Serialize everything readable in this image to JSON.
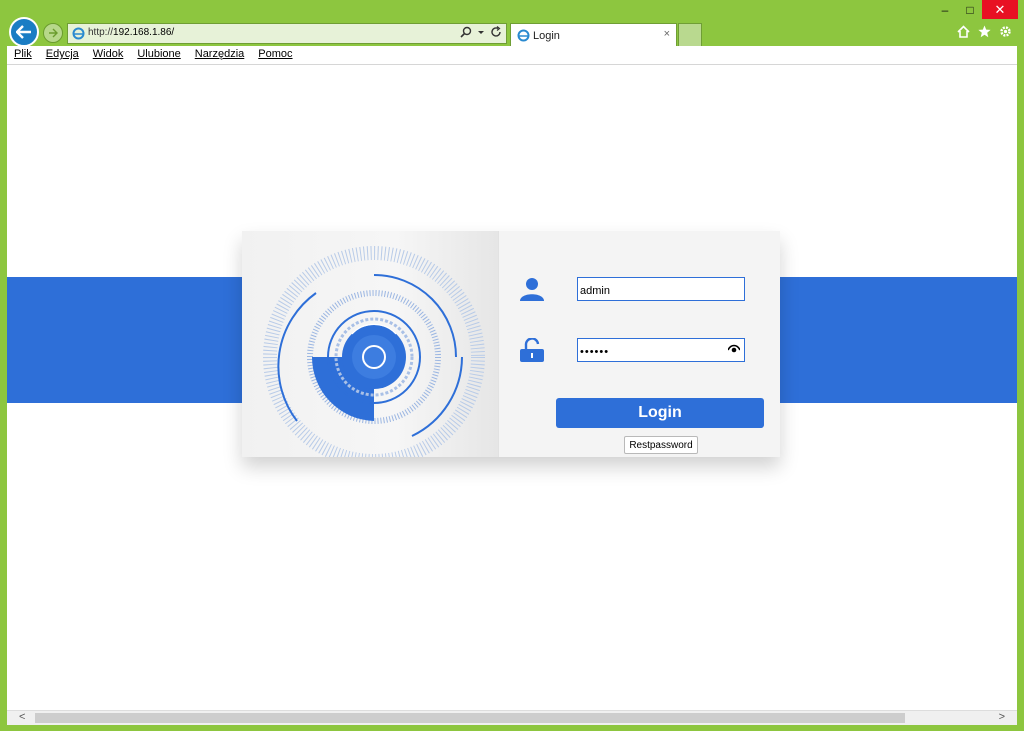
{
  "browser": {
    "address": {
      "prefix": "http://",
      "host": "192.168.1.86/"
    },
    "tab": {
      "title": "Login",
      "close": "×"
    },
    "window_controls": {
      "minimize": "–",
      "maximize": "□",
      "close": "✕"
    }
  },
  "menu": [
    "Plik",
    "Edycja",
    "Widok",
    "Ulubione",
    "Narzędzia",
    "Pomoc"
  ],
  "login": {
    "username_value": "admin",
    "password_value": "••••••",
    "login_label": "Login",
    "reset_label": "Restpassword"
  },
  "scrollbar": {
    "left": "<",
    "right": ">"
  },
  "colors": {
    "brand_blue": "#2e6fd8",
    "chrome_green": "#8dc63f",
    "close_red": "#e81123"
  }
}
